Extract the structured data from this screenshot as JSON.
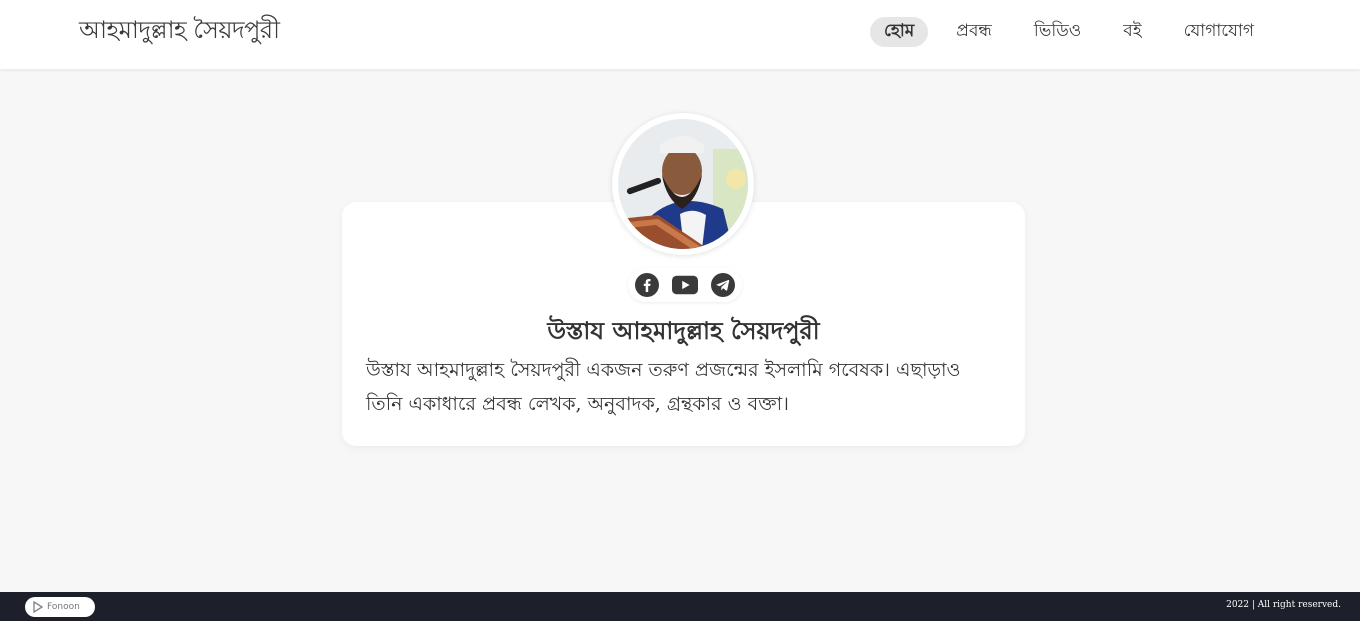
{
  "header": {
    "logo": "আহমাদুল্লাহ সৈয়দপুরী",
    "nav": [
      {
        "label": "হোম",
        "active": true
      },
      {
        "label": "প্রবন্ধ",
        "active": false
      },
      {
        "label": "ভিডিও",
        "active": false
      },
      {
        "label": "বই",
        "active": false
      },
      {
        "label": "যোগাযোগ",
        "active": false
      }
    ]
  },
  "profile": {
    "name": "উস্তায আহমাদুল্লাহ সৈয়দপুরী",
    "bio": "উস্তায আহমাদুল্লাহ সৈয়দপুরী একজন তরুণ প্রজন্মের ইসলামি গবেষক। এছাড়াও তিনি একাধারে প্রবন্ধ লেখক, অনুবাদক, গ্রন্থকার ও বক্তা।",
    "socials": [
      "facebook-icon",
      "youtube-icon",
      "telegram-icon"
    ]
  },
  "footer": {
    "badge": "Fonoon",
    "copyright": "2022 | All right reserved."
  },
  "colors": {
    "footer_bg": "#1d202b",
    "page_bg": "#f7f7f7",
    "icon": "#3a3a3a"
  }
}
